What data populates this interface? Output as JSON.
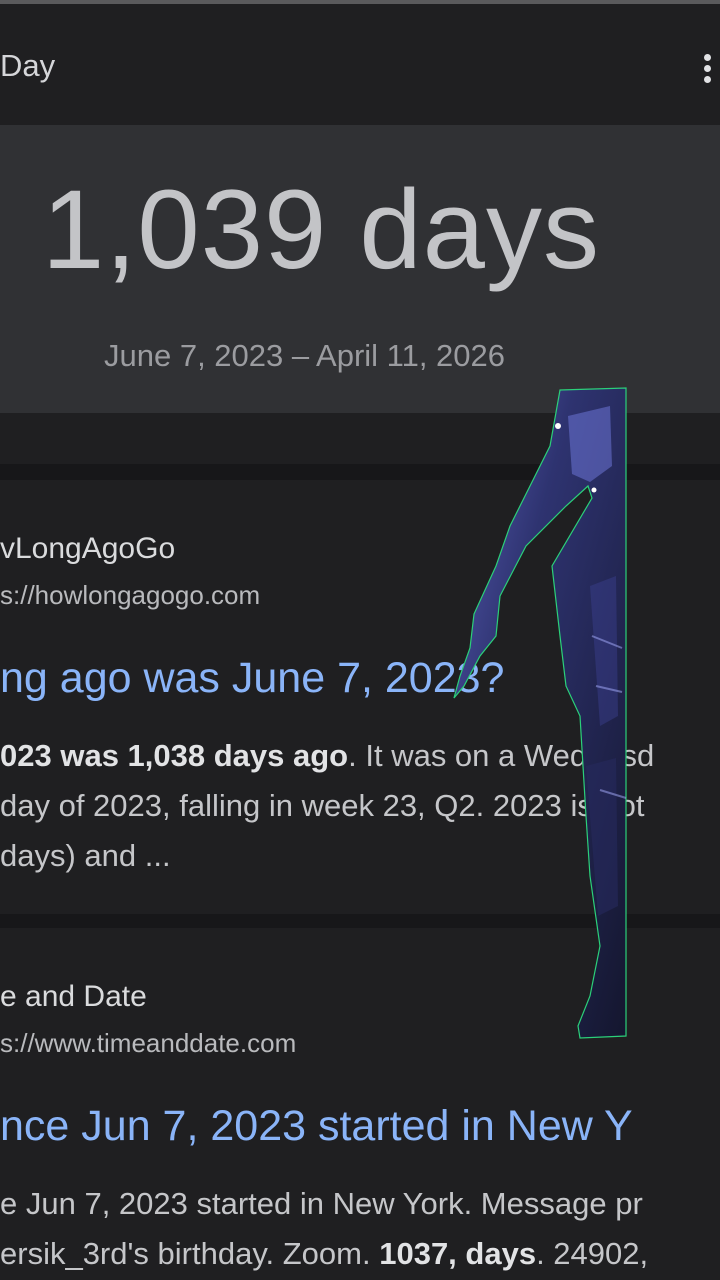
{
  "header": {
    "title": "Day",
    "menu_icon": "more-vert-icon"
  },
  "answer": {
    "value": "1,039 days",
    "range": "June 7, 2023 – April 11, 2026"
  },
  "results": [
    {
      "site_name": "vLongAgoGo",
      "url": "s://howlongagogo.com",
      "title": "ng ago was June 7, 2023?",
      "snippet": {
        "line1_bold": "023 was 1,038 days ago",
        "line1_rest": ". It was on a Wednesd",
        "line2": "day of 2023, falling in week 23, Q2. 2023 is not",
        "line3": "days) and ..."
      }
    },
    {
      "site_name": "e and Date",
      "url": "s://www.timeanddate.com",
      "title": "nce Jun 7, 2023 started in New Y",
      "snippet": {
        "line1": "e Jun 7, 2023 started in New York. Message pr",
        "line2_pre": "ersik_3rd's birthday. Zoom. ",
        "line2_bold": "1037, days",
        "line2_post": ". 24902,"
      }
    }
  ],
  "colors": {
    "background": "#1f1f21",
    "card": "#303134",
    "link": "#8ab4f8",
    "figure": "#2a2f5c"
  }
}
